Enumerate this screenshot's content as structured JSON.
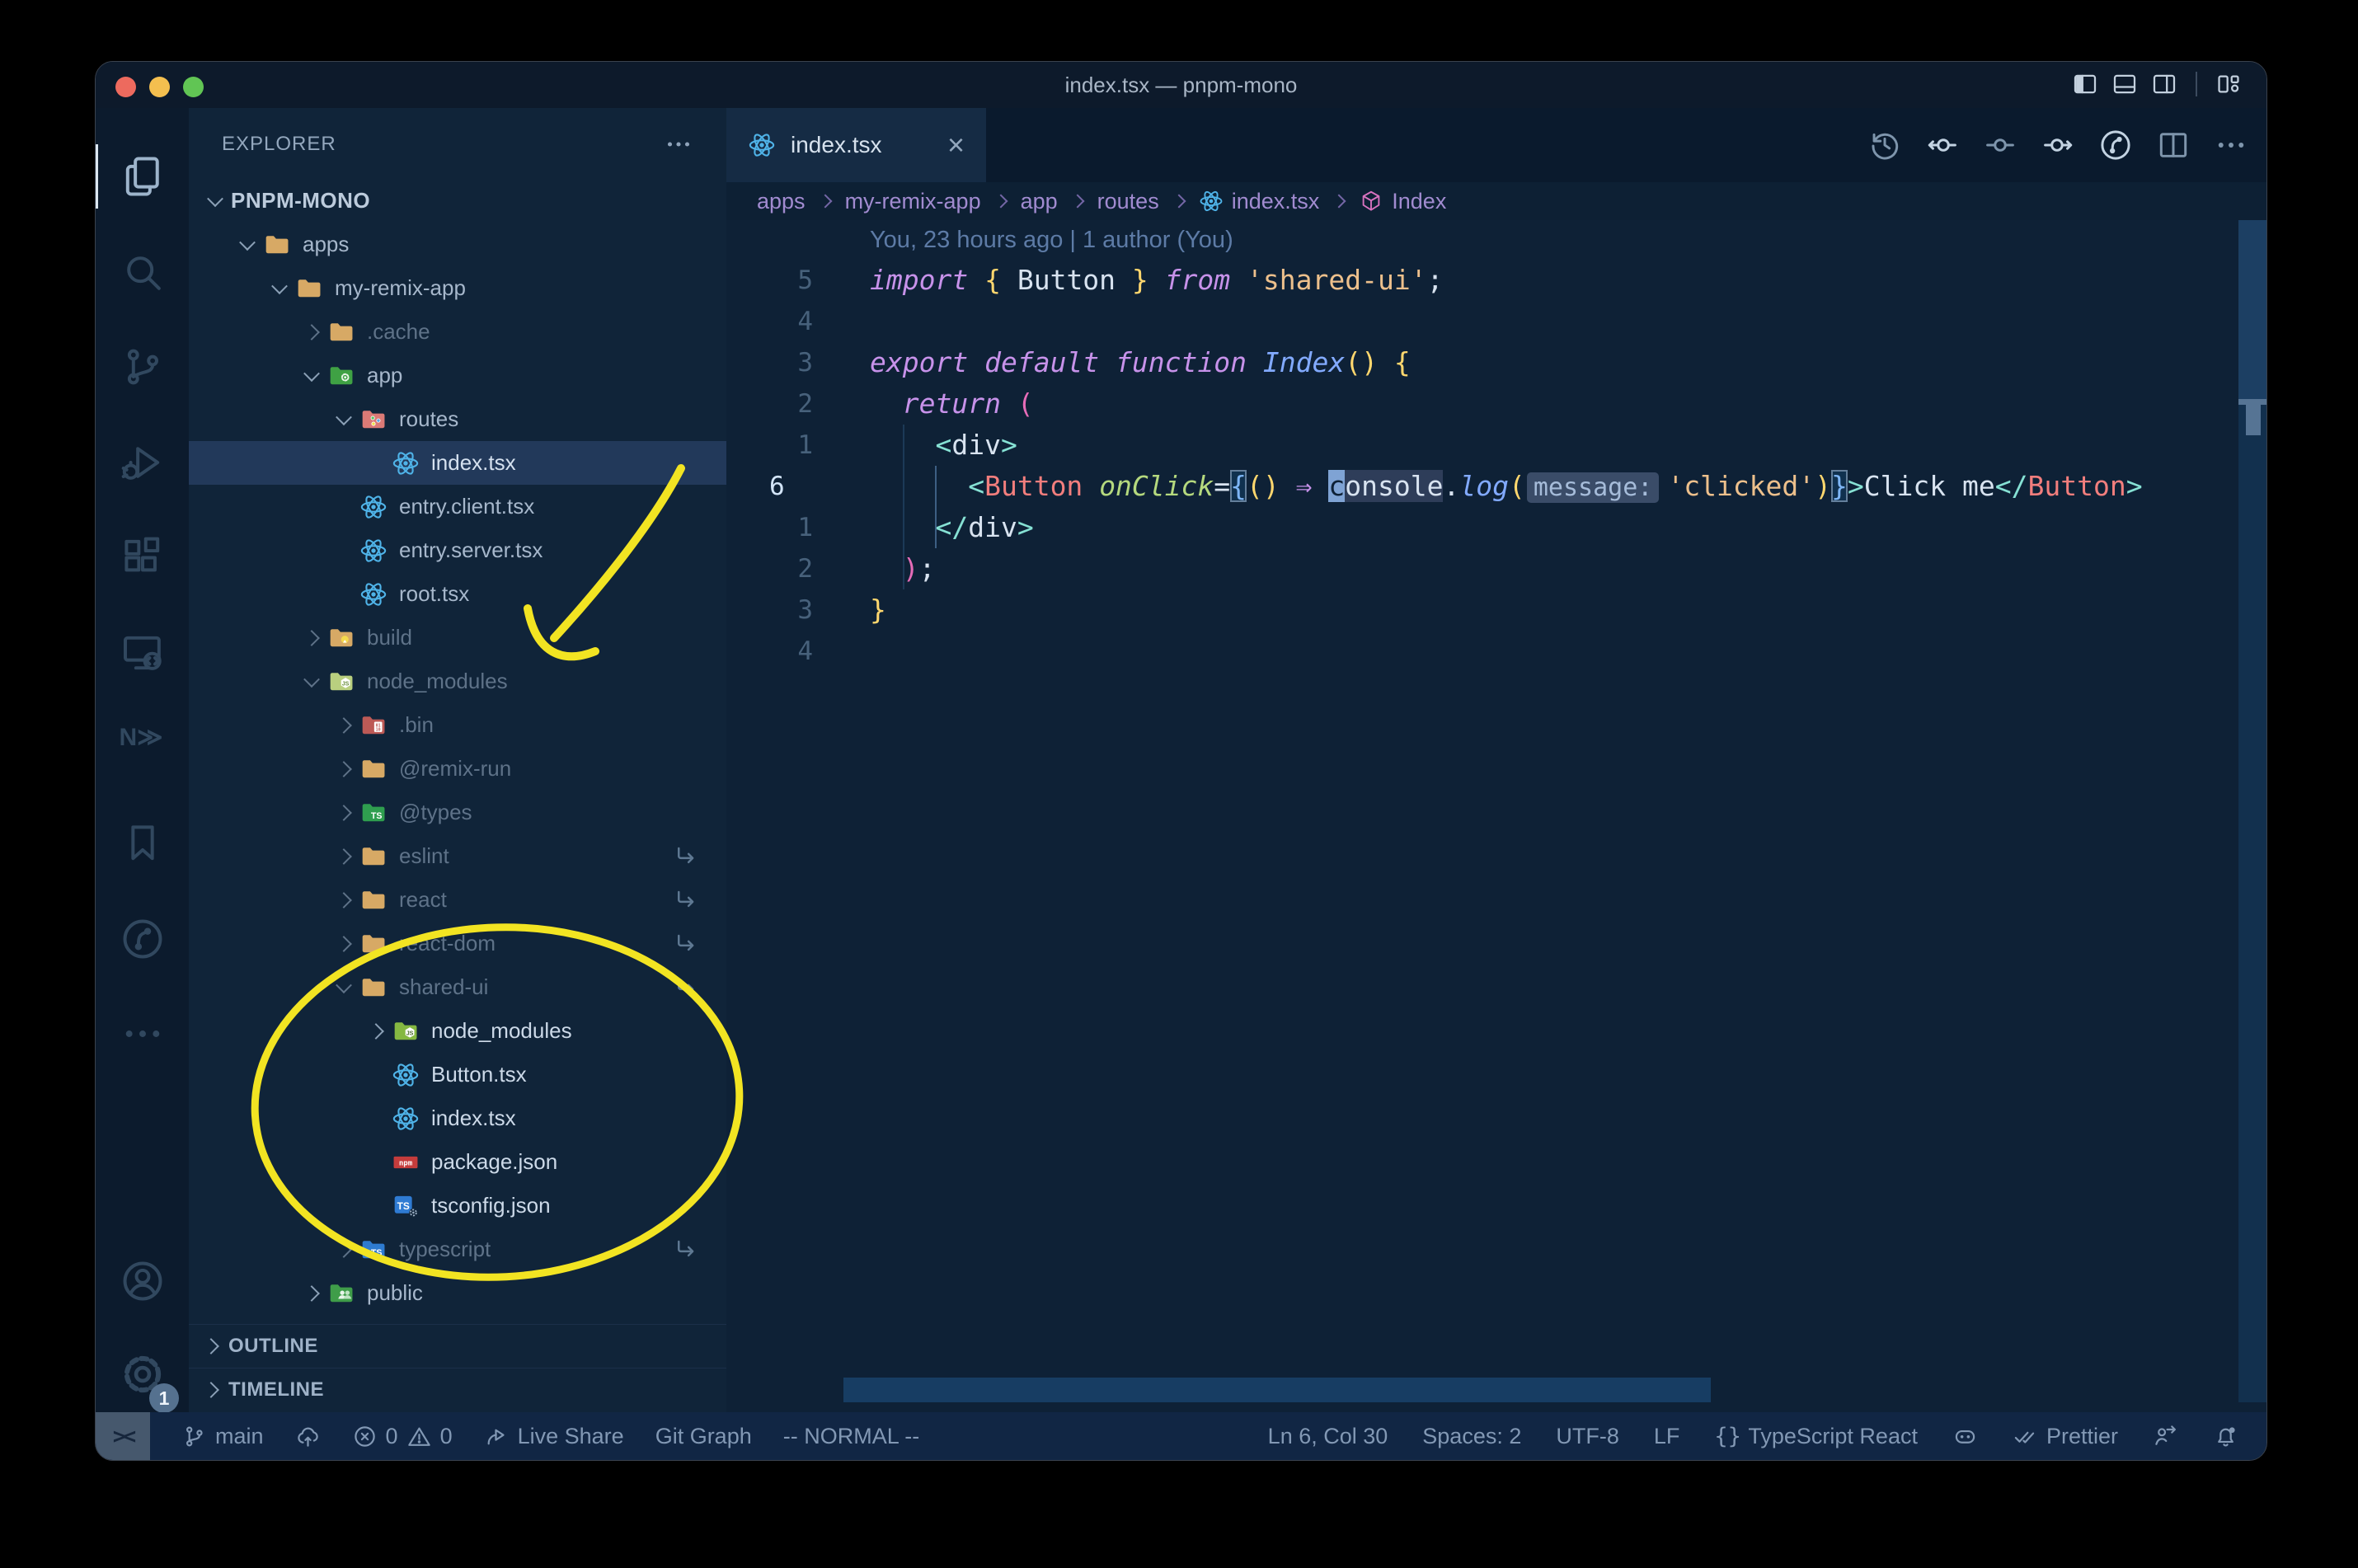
{
  "window": {
    "title": "index.tsx — pnpm-mono",
    "controls": [
      "close-button",
      "minimize-button",
      "zoom-button"
    ],
    "layout_icons": [
      "layout-sidebar-left",
      "layout-panel",
      "layout-sidebar-right",
      "layout-customize"
    ]
  },
  "activity_bar": {
    "top": [
      {
        "icon": "files",
        "active": true
      },
      {
        "icon": "search"
      },
      {
        "icon": "source-control"
      },
      {
        "icon": "run-debug"
      },
      {
        "icon": "extensions"
      },
      {
        "icon": "remote-explorer"
      },
      {
        "icon": "nx-console"
      },
      {
        "icon": "bookmarks"
      },
      {
        "icon": "git-graph"
      },
      {
        "icon": "more"
      }
    ],
    "bottom": [
      {
        "icon": "account"
      },
      {
        "icon": "settings",
        "badge": "1"
      }
    ]
  },
  "sidebar": {
    "header": "EXPLORER",
    "tree": [
      {
        "label": "PNPM-MONO",
        "depth": 0,
        "root": true,
        "expanded": true
      },
      {
        "label": "apps",
        "icon": "folder",
        "depth": 1,
        "expanded": true
      },
      {
        "label": "my-remix-app",
        "icon": "folder",
        "depth": 2,
        "expanded": true
      },
      {
        "label": ".cache",
        "icon": "folder",
        "depth": 3,
        "expanded": false,
        "dimmed": true
      },
      {
        "label": "app",
        "icon": "folder-app",
        "depth": 3,
        "expanded": true
      },
      {
        "label": "routes",
        "icon": "folder-routes",
        "depth": 4,
        "expanded": true
      },
      {
        "label": "index.tsx",
        "icon": "react",
        "depth": 5,
        "file": true,
        "selected": true
      },
      {
        "label": "entry.client.tsx",
        "icon": "react",
        "depth": 4,
        "file": true
      },
      {
        "label": "entry.server.tsx",
        "icon": "react",
        "depth": 4,
        "file": true
      },
      {
        "label": "root.tsx",
        "icon": "react",
        "depth": 4,
        "file": true
      },
      {
        "label": "build",
        "icon": "folder-build",
        "depth": 3,
        "expanded": false,
        "dimmed": true
      },
      {
        "label": "node_modules",
        "icon": "folder-nm-pale",
        "depth": 3,
        "expanded": true,
        "dimmed": true
      },
      {
        "label": ".bin",
        "icon": "folder-bin",
        "depth": 4,
        "expanded": false,
        "dimmed": true
      },
      {
        "label": "@remix-run",
        "icon": "folder",
        "depth": 4,
        "expanded": false,
        "dimmed": true
      },
      {
        "label": "@types",
        "icon": "folder-types",
        "depth": 4,
        "expanded": false,
        "dimmed": true
      },
      {
        "label": "eslint",
        "icon": "folder",
        "depth": 4,
        "expanded": false,
        "dimmed": true,
        "symlink": true
      },
      {
        "label": "react",
        "icon": "folder",
        "depth": 4,
        "expanded": false,
        "dimmed": true,
        "symlink": true
      },
      {
        "label": "react-dom",
        "icon": "folder",
        "depth": 4,
        "expanded": false,
        "dimmed": true,
        "symlink": true
      },
      {
        "label": "shared-ui",
        "icon": "folder",
        "depth": 4,
        "expanded": true,
        "dimmed": true,
        "symlink": true
      },
      {
        "label": "node_modules",
        "icon": "folder-nm",
        "depth": 5,
        "expanded": false,
        "bright": true
      },
      {
        "label": "Button.tsx",
        "icon": "react",
        "depth": 5,
        "file": true,
        "bright": true
      },
      {
        "label": "index.tsx",
        "icon": "react",
        "depth": 5,
        "file": true,
        "bright": true
      },
      {
        "label": "package.json",
        "icon": "npm",
        "depth": 5,
        "file": true,
        "bright": true
      },
      {
        "label": "tsconfig.json",
        "icon": "ts-gear",
        "depth": 5,
        "file": true,
        "bright": true
      },
      {
        "label": "typescript",
        "icon": "folder-ts",
        "depth": 4,
        "expanded": false,
        "dimmed": true,
        "symlink": true
      },
      {
        "label": "public",
        "icon": "folder-public",
        "depth": 3,
        "expanded": false
      }
    ],
    "panels": [
      "OUTLINE",
      "TIMELINE"
    ]
  },
  "editor": {
    "tab": {
      "label": "index.tsx",
      "icon": "react",
      "close_glyph": "×"
    },
    "actions": [
      "history",
      "nav-back",
      "nav-circle",
      "nav-forward",
      "git-graph",
      "split-editor",
      "more"
    ],
    "breadcrumbs": [
      {
        "label": "apps"
      },
      {
        "label": "my-remix-app"
      },
      {
        "label": "app"
      },
      {
        "label": "routes"
      },
      {
        "label": "index.tsx",
        "icon": "react"
      },
      {
        "label": "Index",
        "icon": "symbol-module"
      }
    ],
    "gitlens": "You, 23 hours ago | 1 author (You)",
    "lines": [
      {
        "num": "5",
        "guides": [],
        "tokens": [
          {
            "t": "import",
            "s": "kw"
          },
          {
            "t": " ",
            "s": "pl"
          },
          {
            "t": "{",
            "s": "y"
          },
          {
            "t": " Button ",
            "s": "pl"
          },
          {
            "t": "}",
            "s": "y"
          },
          {
            "t": " ",
            "s": "pl"
          },
          {
            "t": "from",
            "s": "kw"
          },
          {
            "t": " ",
            "s": "pl"
          },
          {
            "t": "'shared-ui'",
            "s": "str"
          },
          {
            "t": ";",
            "s": "pl"
          }
        ]
      },
      {
        "num": "4",
        "guides": [],
        "tokens": []
      },
      {
        "num": "3",
        "guides": [],
        "tokens": [
          {
            "t": "export",
            "s": "kw"
          },
          {
            "t": " ",
            "s": "pl"
          },
          {
            "t": "default",
            "s": "kw"
          },
          {
            "t": " ",
            "s": "pl"
          },
          {
            "t": "function",
            "s": "kw"
          },
          {
            "t": " ",
            "s": "pl"
          },
          {
            "t": "Index",
            "s": "fn"
          },
          {
            "t": "()",
            "s": "y"
          },
          {
            "t": " ",
            "s": "pl"
          },
          {
            "t": "{",
            "s": "y"
          }
        ]
      },
      {
        "num": "2",
        "guides": [],
        "tokens": [
          {
            "t": "  ",
            "s": "pl"
          },
          {
            "t": "return",
            "s": "kw"
          },
          {
            "t": " ",
            "s": "pl"
          },
          {
            "t": "(",
            "s": "pink"
          }
        ]
      },
      {
        "num": "1",
        "guides": [
          [
            2,
            0
          ]
        ],
        "tokens": [
          {
            "t": "    ",
            "s": "pl"
          },
          {
            "t": "<",
            "s": "ang"
          },
          {
            "t": "div",
            "s": "pl"
          },
          {
            "t": ">",
            "s": "ang"
          }
        ]
      },
      {
        "num": "6",
        "cur": true,
        "guides": [
          [
            2,
            0
          ],
          [
            4,
            1
          ]
        ],
        "tokens": [
          {
            "t": "      ",
            "s": "pl"
          },
          {
            "t": "<",
            "s": "ang"
          },
          {
            "t": "Button",
            "s": "tag"
          },
          {
            "t": " ",
            "s": "pl"
          },
          {
            "t": "onClick",
            "s": "attr"
          },
          {
            "t": "=",
            "s": "pl"
          },
          {
            "t": "{",
            "s": "bb",
            "box": true
          },
          {
            "t": "()",
            "s": "y"
          },
          {
            "t": " ",
            "s": "pl"
          },
          {
            "t": "⇒",
            "s": "kw"
          },
          {
            "t": " ",
            "s": "pl"
          },
          {
            "t": "c",
            "s": "pl",
            "cursor": true
          },
          {
            "t": "onsole",
            "s": "pl",
            "hl": true
          },
          {
            "t": ".",
            "s": "pl"
          },
          {
            "t": "log",
            "s": "fn"
          },
          {
            "t": "(",
            "s": "y"
          },
          {
            "t": "message:",
            "s": "pl",
            "inlay": true
          },
          {
            "t": "'clicked'",
            "s": "str"
          },
          {
            "t": ")",
            "s": "y"
          },
          {
            "t": "}",
            "s": "bb",
            "box": true
          },
          {
            "t": ">",
            "s": "ang"
          },
          {
            "t": "Click me",
            "s": "pl"
          },
          {
            "t": "</",
            "s": "ang"
          },
          {
            "t": "Button",
            "s": "tag"
          },
          {
            "t": ">",
            "s": "ang"
          }
        ]
      },
      {
        "num": "1",
        "guides": [
          [
            2,
            0
          ],
          [
            4,
            1
          ]
        ],
        "tokens": [
          {
            "t": "    ",
            "s": "pl"
          },
          {
            "t": "</",
            "s": "ang"
          },
          {
            "t": "div",
            "s": "pl"
          },
          {
            "t": ">",
            "s": "ang"
          }
        ]
      },
      {
        "num": "2",
        "guides": [
          [
            2,
            0
          ]
        ],
        "tokens": [
          {
            "t": "  ",
            "s": "pl"
          },
          {
            "t": ")",
            "s": "pink"
          },
          {
            "t": ";",
            "s": "pl"
          }
        ]
      },
      {
        "num": "3",
        "guides": [],
        "tokens": [
          {
            "t": "}",
            "s": "y"
          }
        ]
      },
      {
        "num": "4",
        "guides": [],
        "tokens": []
      }
    ]
  },
  "status_bar": {
    "left": [
      {
        "name": "remote-indicator",
        "icon": "remote",
        "box": true
      },
      {
        "name": "branch-indicator",
        "icon": "branch",
        "text": "main"
      },
      {
        "name": "sync-button",
        "icon": "cloud-upload"
      },
      {
        "name": "problems",
        "parts": [
          {
            "icon": "error",
            "text": "0"
          },
          {
            "icon": "warning",
            "text": "0"
          }
        ]
      },
      {
        "name": "live-share",
        "icon": "live-share",
        "text": "Live Share"
      },
      {
        "name": "git-graph",
        "text": "Git Graph"
      },
      {
        "name": "vim-mode",
        "text": "-- NORMAL --"
      }
    ],
    "right": [
      {
        "name": "cursor-position",
        "text": "Ln 6, Col 30"
      },
      {
        "name": "indentation",
        "text": "Spaces: 2"
      },
      {
        "name": "encoding",
        "text": "UTF-8"
      },
      {
        "name": "eol",
        "text": "LF"
      },
      {
        "name": "language-mode",
        "icon": "brackets",
        "text": "TypeScript React"
      },
      {
        "name": "copilot",
        "icon": "copilot"
      },
      {
        "name": "prettier",
        "icon": "double-check",
        "text": "Prettier"
      },
      {
        "name": "feedback",
        "icon": "feedback"
      },
      {
        "name": "notifications",
        "icon": "bell-dot"
      }
    ]
  },
  "annotations": {
    "color": "#f2e422"
  },
  "colors": {
    "accent_yellow": "#f2e422",
    "editor_bg": "#0e2136",
    "sidebar_bg": "#102439",
    "selection_bg": "#22395a",
    "status_bg": "#112644",
    "traffic_red": "#ed6a5e",
    "traffic_yellow": "#f4bf4f",
    "traffic_green": "#61c554",
    "react_blue": "#4fb3e8",
    "breadcrumb_purple": "#a18bd0"
  }
}
